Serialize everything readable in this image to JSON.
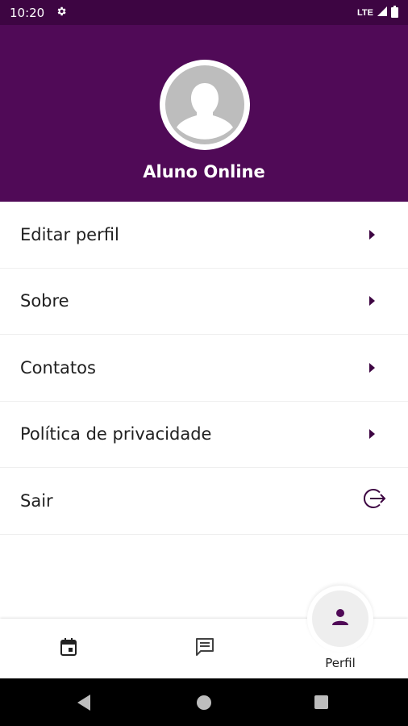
{
  "status_bar": {
    "time": "10:20",
    "network": "LTE"
  },
  "profile": {
    "name": "Aluno Online"
  },
  "menu": [
    {
      "label": "Editar perfil",
      "icon": "chevron-right-icon"
    },
    {
      "label": "Sobre",
      "icon": "chevron-right-icon"
    },
    {
      "label": "Contatos",
      "icon": "chevron-right-icon"
    },
    {
      "label": "Política de privacidade",
      "icon": "chevron-right-icon"
    },
    {
      "label": "Sair",
      "icon": "logout-icon"
    }
  ],
  "bottom_nav": {
    "items": [
      {
        "icon": "calendar-icon"
      },
      {
        "icon": "chat-icon"
      },
      {
        "icon": "person-icon",
        "label": "Perfil",
        "active": true
      }
    ]
  },
  "colors": {
    "header": "#500a57",
    "status_bar": "#3d0542",
    "accent": "#3d0542"
  }
}
